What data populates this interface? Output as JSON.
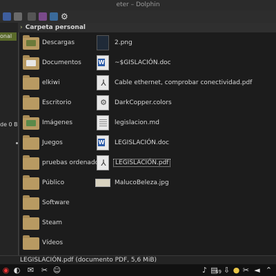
{
  "window": {
    "title": "eter – Dolphin"
  },
  "breadcrumb": {
    "label": "Carpeta personal"
  },
  "left_panel": {
    "selected_label": "onal",
    "free_space_text": "de 0 B"
  },
  "folders": [
    {
      "label": "Descargas"
    },
    {
      "label": "Documentos"
    },
    {
      "label": "elkiwi"
    },
    {
      "label": "Escritorio"
    },
    {
      "label": "Imágenes"
    },
    {
      "label": "Juegos"
    },
    {
      "label": "pruebas ordenador"
    },
    {
      "label": "Público"
    },
    {
      "label": "Software"
    },
    {
      "label": "Steam"
    },
    {
      "label": "Vídeos"
    }
  ],
  "files": [
    {
      "label": "2.png",
      "icon": "image-file-icon"
    },
    {
      "label": "~$GISLACIÓN.doc",
      "icon": "word-document-icon"
    },
    {
      "label": "Cable ethernet, comprobar conectividad.pdf",
      "icon": "pdf-file-icon"
    },
    {
      "label": "DarkCopper.colors",
      "icon": "colors-file-icon"
    },
    {
      "label": "legislacion.md",
      "icon": "text-file-icon"
    },
    {
      "label": "LEGISLACIÓN.doc",
      "icon": "word-document-icon"
    },
    {
      "label": "LEGISLACIÓN.pdf",
      "icon": "pdf-file-icon"
    },
    {
      "label": "MalucoBeleza.jpg",
      "icon": "image-file-icon"
    }
  ],
  "status": {
    "text": "LEGISLACIÓN.pdf (documento PDF, 5,6 MiB)"
  },
  "taskbar": {
    "badge": "49"
  },
  "colors": {
    "accent": "#5a6a2a",
    "folder": "#b89a62"
  }
}
